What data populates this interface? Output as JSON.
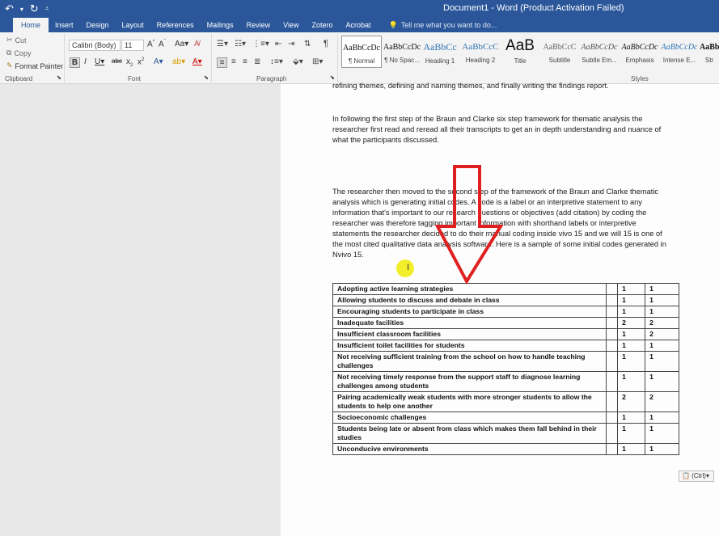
{
  "window": {
    "title": "Document1 - Word (Product Activation Failed)"
  },
  "tabs": [
    "Home",
    "Insert",
    "Design",
    "Layout",
    "References",
    "Mailings",
    "Review",
    "View",
    "Zotero",
    "Acrobat"
  ],
  "tell_me": "Tell me what you want to do...",
  "clipboard": {
    "cut": "Cut",
    "copy": "Copy",
    "format_painter": "Format Painter",
    "label": "Clipboard"
  },
  "font": {
    "name": "Calibri (Body)",
    "size": "11",
    "label": "Font"
  },
  "paragraph": {
    "label": "Paragraph"
  },
  "styles": {
    "label": "Styles",
    "items": [
      {
        "preview": "AaBbCcDc",
        "name": "¶ Normal"
      },
      {
        "preview": "AaBbCcDc",
        "name": "¶ No Spac..."
      },
      {
        "preview": "AaBbCc",
        "name": "Heading 1"
      },
      {
        "preview": "AaBbCcC",
        "name": "Heading 2"
      },
      {
        "preview": "AaB",
        "name": "Title"
      },
      {
        "preview": "AaBbCcC",
        "name": "Subtitle"
      },
      {
        "preview": "AaBbCcDc",
        "name": "Subtle Em..."
      },
      {
        "preview": "AaBbCcDc",
        "name": "Emphasis"
      },
      {
        "preview": "AaBbCcDc",
        "name": "Intense E..."
      },
      {
        "preview": "AaBbCcDc",
        "name": "Str"
      }
    ]
  },
  "document": {
    "para1": "refining themes, defining and naming themes, and finally writing the findings report.",
    "para2": "In following the first step of the Braun and Clarke six step framework for thematic analysis the researcher first read and reread all their transcripts to get an in depth understanding and nuance of what the participants discussed.",
    "para3": "The researcher then moved to the second step of the framework of the Braun and Clarke thematic analysis which is generating initial codes. A code is a label or an interpretive statement to any information that's important to our research questions or objectives (add citation) by coding the researcher was therefore tagging important information with shorthand labels or interpretive statements the researcher decided to do their manual coding inside vivo 15 and we will 15 is one of the most cited qualitative data analysis software. Here is a sample of some initial codes generated in Nvivo 15.",
    "table": [
      {
        "code": "Adopting  active learning strategies",
        "a": "1",
        "b": "1"
      },
      {
        "code": "Allowing students to discuss and debate in class",
        "a": "1",
        "b": "1"
      },
      {
        "code": "Encouraging students to participate in class",
        "a": "1",
        "b": "1"
      },
      {
        "code": "Inadequate facilities",
        "a": "2",
        "b": "2"
      },
      {
        "code": "Insufficient classroom facilities",
        "a": "1",
        "b": "2"
      },
      {
        "code": "Insufficient toilet facilities for students",
        "a": "1",
        "b": "1"
      },
      {
        "code": "Not receiving sufficient training from the school on how to handle teaching challenges",
        "a": "1",
        "b": "1"
      },
      {
        "code": "Not receiving timely response from the support staff to diagnose learning challenges among students",
        "a": "1",
        "b": "1"
      },
      {
        "code": "Pairing academically weak students with more stronger students to allow the students to help one another",
        "a": "2",
        "b": "2"
      },
      {
        "code": "Socioeconomic challenges",
        "a": "1",
        "b": "1"
      },
      {
        "code": "Students being late or absent from class which makes them fall behind in their studies",
        "a": "1",
        "b": "1"
      },
      {
        "code": "Unconducive environments",
        "a": "1",
        "b": "1"
      }
    ],
    "paste_options": "(Ctrl)"
  }
}
